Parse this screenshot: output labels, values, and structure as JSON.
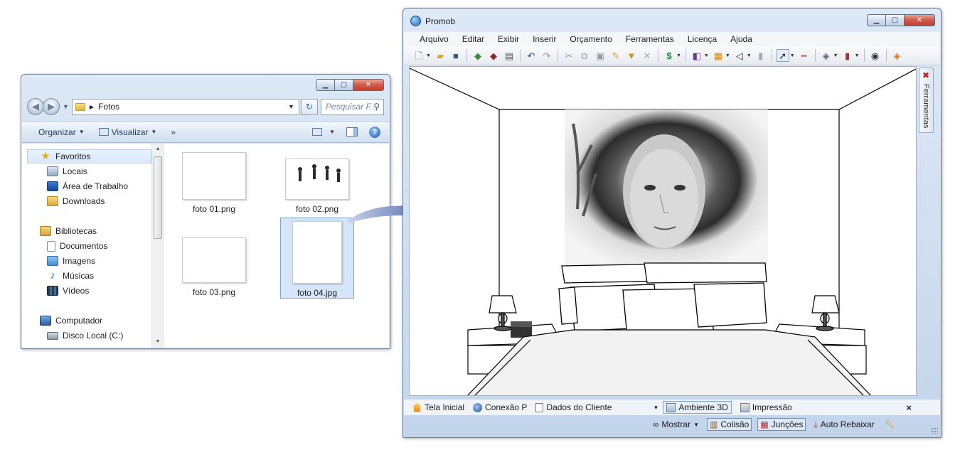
{
  "explorer": {
    "address": {
      "segments": [
        "Fotos"
      ]
    },
    "search": {
      "placeholder": "Pesquisar F..."
    },
    "commands": {
      "organize": "Organizar",
      "view": "Visualizar",
      "more": "»"
    },
    "nav": {
      "favorites": "Favoritos",
      "favorite_items": [
        "Locais",
        "Área de Trabalho",
        "Downloads"
      ],
      "libraries": "Bibliotecas",
      "library_items": [
        "Documentos",
        "Imagens",
        "Músicas",
        "Vídeos"
      ],
      "computer": "Computador",
      "computer_items": [
        "Disco Local (C:)"
      ]
    },
    "files": [
      {
        "name": "foto 01.png"
      },
      {
        "name": "foto 02.png"
      },
      {
        "name": "foto 03.png"
      },
      {
        "name": "foto 04.jpg",
        "selected": true
      }
    ]
  },
  "promob": {
    "title": "Promob",
    "menu": [
      "Arquivo",
      "Editar",
      "Exibir",
      "Inserir",
      "Orçamento",
      "Ferramentas",
      "Licença",
      "Ajuda"
    ],
    "side_tab": "Ferramentas",
    "tabs": [
      "Tela Inicial",
      "Conexão P",
      "Dados do Cliente",
      "Ambiente 3D",
      "Impressão"
    ],
    "active_tab": "Ambiente 3D",
    "tabs_close": "×",
    "status": {
      "show": "Mostrar",
      "collision": "Colisão",
      "joints": "Junções",
      "auto_lower": "Auto Rebaixar"
    }
  },
  "colors": {
    "accent": "#3b6bb0",
    "arrow": "#5b73b0",
    "selection": "#d5e6fb"
  }
}
